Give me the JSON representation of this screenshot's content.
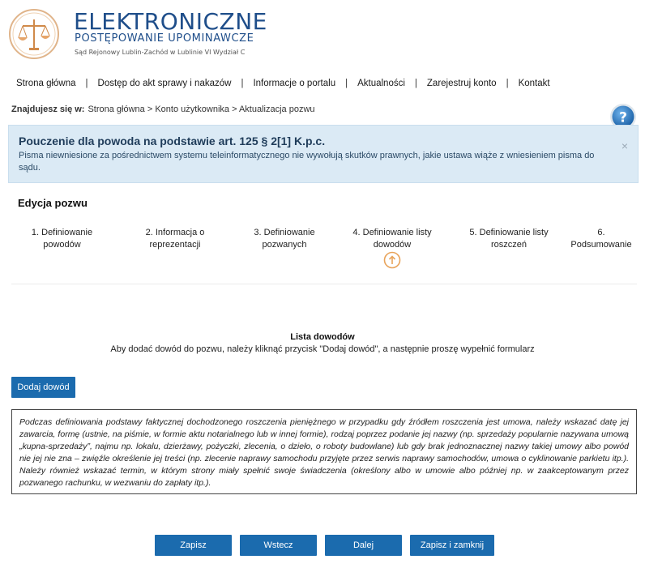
{
  "header": {
    "brand_title": "ELEKTRONICZNE",
    "brand_subtitle": "POSTĘPOWANIE UPOMINAWCZE",
    "court_name": "Sąd Rejonowy Lublin-Zachód w Lublinie VI Wydział Cyw"
  },
  "nav": {
    "items": [
      {
        "label": "Strona główna"
      },
      {
        "label": "Dostęp do akt sprawy i nakazów"
      },
      {
        "label": "Informacje o portalu"
      },
      {
        "label": "Aktualności"
      },
      {
        "label": "Zarejestruj konto"
      },
      {
        "label": "Kontakt"
      }
    ],
    "separator": "|"
  },
  "breadcrumb": {
    "prefix": "Znajdujesz się w:",
    "path": "Strona główna > Konto użytkownika > Aktualizacja pozwu"
  },
  "alert": {
    "title": "Pouczenie dla powoda na podstawie art. 125 § 2[1] K.p.c.",
    "text": "Pisma niewniesione za pośrednictwem systemu teleinformatycznego nie wywołują skutków prawnych, jakie ustawa wiąże z wniesieniem pisma do sądu.",
    "close": "×"
  },
  "section_title": "Edycja pozwu",
  "steps": [
    {
      "line1": "1. Definiowanie",
      "line2": "powodów"
    },
    {
      "line1": "2. Informacja o",
      "line2": "reprezentacji"
    },
    {
      "line1": "3. Definiowanie",
      "line2": "pozwanych"
    },
    {
      "line1": "4. Definiowanie listy",
      "line2": "dowodów",
      "active": true
    },
    {
      "line1": "5. Definiowanie listy",
      "line2": "roszczeń"
    },
    {
      "line1": "6.",
      "line2": "Podsumowanie"
    }
  ],
  "evidence": {
    "title": "Lista dowodów",
    "description": "Aby dodać dowód do pozwu, należy kliknąć przycisk \"Dodaj dowód\", a następnie proszę wypełnić formularz",
    "add_button": "Dodaj dowód"
  },
  "notice": "Podczas definiowania podstawy faktycznej dochodzonego roszczenia pieniężnego w przypadku gdy źródłem roszczenia jest umowa, należy wskazać datę jej zawarcia, formę (ustnie, na piśmie, w formie aktu notarialnego lub w innej formie), rodzaj poprzez podanie jej nazwy (np. sprzedaży popularnie nazywana umową „kupna-sprzedaży”, najmu np. lokalu, dzierżawy, pożyczki, zlecenia, o dzieło, o roboty budowlane) lub gdy brak jednoznacznej nazwy takiej umowy albo powód nie jej nie zna – zwięźle określenie jej treści (np. zlecenie naprawy samochodu przyjęte przez serwis naprawy samochodów, umowa o cyklinowanie parkietu itp.). Należy również wskazać termin, w którym strony miały spełnić swoje świadczenia (określony albo w umowie albo później np. w zaakceptowanym przez pozwanego rachunku, w wezwaniu do zapłaty itp.).",
  "actions": {
    "save": "Zapisz",
    "back": "Wstecz",
    "next": "Dalej",
    "save_close": "Zapisz i zamknij"
  },
  "colors": {
    "brand": "#1f4e8a",
    "button": "#1b6bae",
    "alert_bg": "#dbeaf5",
    "step_marker": "#e8a35a",
    "help_icon": "#2a7ac0"
  },
  "icons": {
    "logo": "scales-of-justice-icon",
    "help": "question-mark-icon",
    "step_marker": "arrow-up-circle-icon",
    "alert_close": "close-icon"
  }
}
